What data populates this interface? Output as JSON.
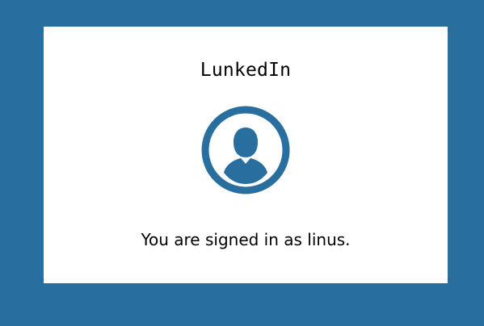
{
  "app": {
    "brand_name": "LunkedIn"
  },
  "profile": {
    "avatar_icon": "user-silhouette-icon",
    "signed_in_message": "You are signed in as linus."
  },
  "colors": {
    "background": "#286e9f",
    "card": "#ffffff",
    "accent": "#286e9f",
    "text": "#000000"
  }
}
